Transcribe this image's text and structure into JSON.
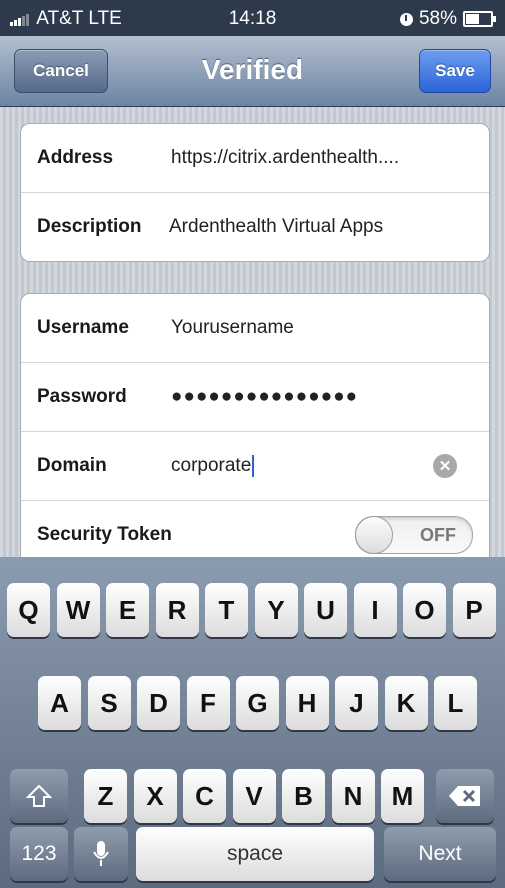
{
  "status_bar": {
    "carrier": "AT&T",
    "network": "LTE",
    "time": "14:18",
    "battery": "58%",
    "battery_level": 0.58
  },
  "nav": {
    "title": "Verified",
    "cancel_label": "Cancel",
    "save_label": "Save"
  },
  "server": {
    "address_label": "Address",
    "address_value": "https://citrix.ardenthealth....",
    "description_label": "Description",
    "description_value": "Ardenthealth Virtual Apps"
  },
  "credentials": {
    "username_label": "Username",
    "username_value": "Yourusername",
    "password_label": "Password",
    "password_value": "●●●●●●●●●●●●●●●",
    "domain_label": "Domain",
    "domain_value": "corporate",
    "token_label": "Security Token",
    "token_state": "OFF"
  },
  "keyboard": {
    "row1": [
      "Q",
      "W",
      "E",
      "R",
      "T",
      "Y",
      "U",
      "I",
      "O",
      "P"
    ],
    "row2": [
      "A",
      "S",
      "D",
      "F",
      "G",
      "H",
      "J",
      "K",
      "L"
    ],
    "row3": [
      "Z",
      "X",
      "C",
      "V",
      "B",
      "N",
      "M"
    ],
    "numbers_label": "123",
    "space_label": "space",
    "next_label": "Next"
  },
  "colors": {
    "nav_gradient_top": "#b3bfcf",
    "nav_gradient_bottom": "#6d84a3",
    "save_blue": "#2b64d8",
    "caret_blue": "#2a64d6"
  }
}
